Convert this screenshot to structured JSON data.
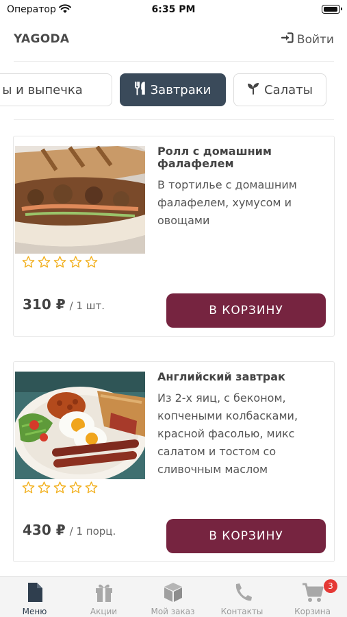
{
  "status_bar": {
    "carrier": "Оператор",
    "time": "6:35 PM"
  },
  "header": {
    "logo": "YAGODA",
    "login_label": "Войти"
  },
  "categories": [
    {
      "label": "ы и выпечка",
      "icon": "pastry-icon",
      "active": false
    },
    {
      "label": "Завтраки",
      "icon": "cutlery-icon",
      "active": true
    },
    {
      "label": "Салаты",
      "icon": "sprout-icon",
      "active": false
    }
  ],
  "products": [
    {
      "title": "Ролл с домашним фалафелем",
      "description": "В тортилье с домашним фалафелем, хумусом и овощами",
      "price": "310 ₽",
      "unit": "/ 1 шт.",
      "rating": 0,
      "button": "В КОРЗИНУ"
    },
    {
      "title": "Английский завтрак",
      "description": "Из 2-х яиц, с беконом, копчеными колбасками, красной фасолью, микс салатом и тостом со сливочным маслом",
      "price": "430 ₽",
      "unit": "/ 1 порц.",
      "rating": 0,
      "button": "В КОРЗИНУ"
    }
  ],
  "tabbar": {
    "items": [
      {
        "label": "Меню",
        "icon": "document-icon",
        "active": true
      },
      {
        "label": "Акции",
        "icon": "gift-icon",
        "active": false
      },
      {
        "label": "Мой заказ",
        "icon": "box-icon",
        "active": false
      },
      {
        "label": "Контакты",
        "icon": "phone-icon",
        "active": false
      },
      {
        "label": "Корзина",
        "icon": "cart-icon",
        "active": false
      }
    ],
    "cart_badge": "3"
  },
  "colors": {
    "accent": "#762440",
    "active_chip": "#3a4a5a",
    "star": "#f2b01e",
    "badge": "#e53935"
  }
}
